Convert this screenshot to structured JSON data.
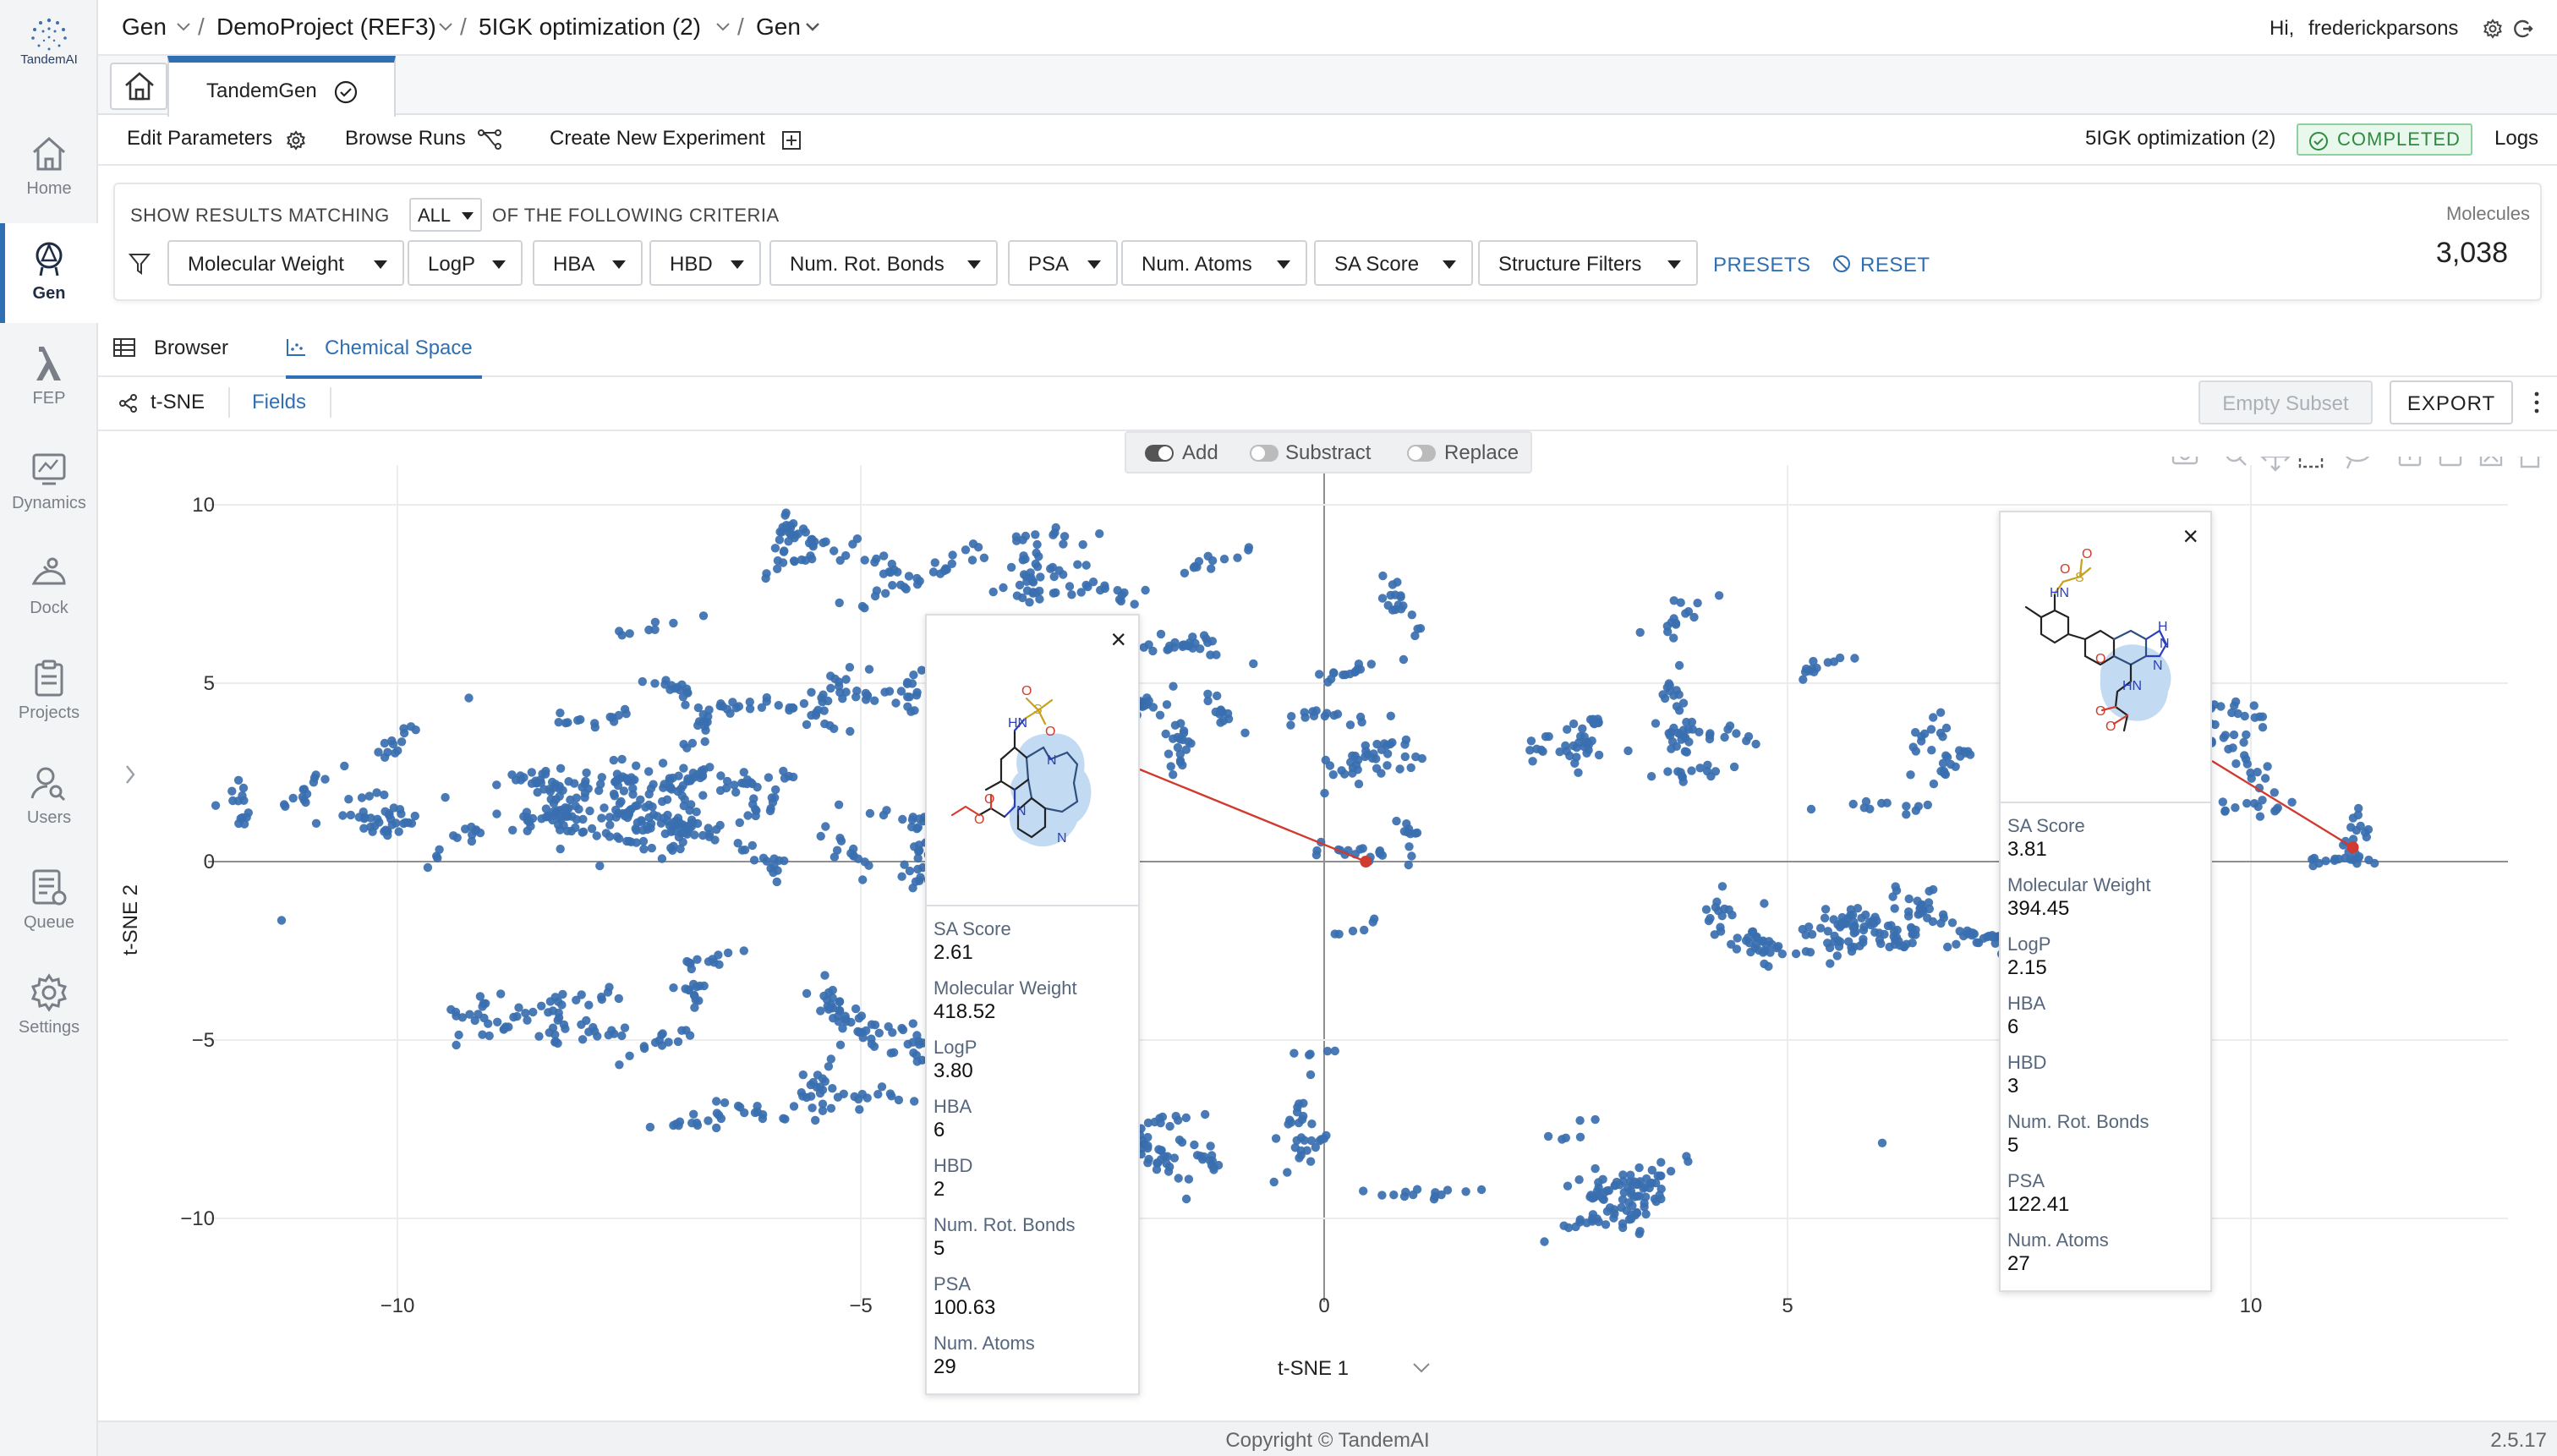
{
  "app": {
    "logo_text": "TandemAI",
    "version": "2.5.17",
    "copyright": "Copyright © TandemAI"
  },
  "nav": {
    "items": [
      {
        "label": "Home",
        "icon": "home-icon"
      },
      {
        "label": "Gen",
        "icon": "gen-icon",
        "active": true
      },
      {
        "label": "FEP",
        "icon": "lambda-icon"
      },
      {
        "label": "Dynamics",
        "icon": "dynamics-icon"
      },
      {
        "label": "Dock",
        "icon": "dock-icon"
      },
      {
        "label": "Projects",
        "icon": "clipboard-icon"
      },
      {
        "label": "Users",
        "icon": "users-icon"
      },
      {
        "label": "Queue",
        "icon": "queue-icon"
      },
      {
        "label": "Settings",
        "icon": "gear-icon"
      }
    ]
  },
  "breadcrumb": {
    "module": "Gen",
    "project": "DemoProject (REF3)",
    "experiment": "5IGK optimization (2)",
    "app": "Gen",
    "separator": "/"
  },
  "user": {
    "greeting": "Hi,",
    "name": "frederickparsons"
  },
  "tabs": {
    "app_tab": "TandemGen"
  },
  "actions": {
    "edit": "Edit Parameters",
    "browse": "Browse Runs",
    "create": "Create New Experiment",
    "run_name": "5IGK optimization (2)",
    "status": "COMPLETED",
    "logs": "Logs"
  },
  "filters": {
    "prefix": "SHOW RESULTS MATCHING",
    "match": "ALL",
    "suffix": "OF THE FOLLOWING CRITERIA",
    "buttons": [
      "Molecular Weight",
      "LogP",
      "HBA",
      "HBD",
      "Num. Rot. Bonds",
      "PSA",
      "Num. Atoms",
      "SA Score",
      "Structure Filters"
    ],
    "presets": "PRESETS",
    "reset": "RESET",
    "molecules_label": "Molecules",
    "molecules_count": "3,038"
  },
  "view_tabs": {
    "browser": "Browser",
    "chemical_space": "Chemical Space"
  },
  "subtoolbar": {
    "method": "t-SNE",
    "fields": "Fields",
    "empty_subset": "Empty Subset",
    "export": "EXPORT"
  },
  "selection": {
    "add": "Add",
    "subtract": "Substract",
    "replace": "Replace"
  },
  "cards": [
    {
      "props": [
        {
          "label": "SA Score",
          "value": "2.61"
        },
        {
          "label": "Molecular Weight",
          "value": "418.52"
        },
        {
          "label": "LogP",
          "value": "3.80"
        },
        {
          "label": "HBA",
          "value": "6"
        },
        {
          "label": "HBD",
          "value": "2"
        },
        {
          "label": "Num. Rot. Bonds",
          "value": "5"
        },
        {
          "label": "PSA",
          "value": "100.63"
        },
        {
          "label": "Num. Atoms",
          "value": "29"
        }
      ]
    },
    {
      "props": [
        {
          "label": "SA Score",
          "value": "3.81"
        },
        {
          "label": "Molecular Weight",
          "value": "394.45"
        },
        {
          "label": "LogP",
          "value": "2.15"
        },
        {
          "label": "HBA",
          "value": "6"
        },
        {
          "label": "HBD",
          "value": "3"
        },
        {
          "label": "Num. Rot. Bonds",
          "value": "5"
        },
        {
          "label": "PSA",
          "value": "122.41"
        },
        {
          "label": "Num. Atoms",
          "value": "27"
        }
      ]
    }
  ],
  "chart_data": {
    "type": "scatter",
    "xlabel": "t-SNE 1",
    "ylabel": "t-SNE 2",
    "xlim": [
      -12,
      12.5
    ],
    "ylim": [
      -11,
      10.5
    ],
    "xticks": [
      -10,
      -5,
      0,
      5,
      10
    ],
    "yticks": [
      10,
      5,
      0,
      -5,
      -10
    ],
    "xtick_labels": [
      "−10",
      "−5",
      "0",
      "5",
      "10"
    ],
    "ytick_labels": [
      "10",
      "5",
      "0",
      "−5",
      "−10"
    ],
    "grid": true,
    "marker_color": "#3a6fb0",
    "highlight_color": "#d03a2f",
    "highlighted_points": [
      [
        0.45,
        0.0
      ],
      [
        11.1,
        0.4
      ]
    ],
    "clusters": [
      {
        "cx": -8.0,
        "cy": 1.3,
        "sx": 1.6,
        "sy": 1.0,
        "n": 340
      },
      {
        "cx": -10.5,
        "cy": 1.3,
        "sx": 0.5,
        "sy": 0.8,
        "n": 40
      },
      {
        "cx": -8.6,
        "cy": -4.0,
        "sx": 0.7,
        "sy": 0.5,
        "n": 70
      },
      {
        "cx": -6.7,
        "cy": -3.8,
        "sx": 0.3,
        "sy": 0.9,
        "n": 40
      },
      {
        "cx": -7.5,
        "cy": 6.3,
        "sx": 0.3,
        "sy": 0.2,
        "n": 8
      },
      {
        "cx": -6.0,
        "cy": 4.2,
        "sx": 1.1,
        "sy": 0.7,
        "n": 110
      },
      {
        "cx": -3.0,
        "cy": 4.2,
        "sx": 1.3,
        "sy": 0.7,
        "n": 120
      },
      {
        "cx": -5.5,
        "cy": 8.6,
        "sx": 0.6,
        "sy": 0.4,
        "n": 45
      },
      {
        "cx": -2.5,
        "cy": 8.3,
        "sx": 2.0,
        "sy": 0.6,
        "n": 120
      },
      {
        "cx": -5.0,
        "cy": 0.7,
        "sx": 1.0,
        "sy": 0.8,
        "n": 70
      },
      {
        "cx": -5.0,
        "cy": -4.2,
        "sx": 0.3,
        "sy": 1.2,
        "n": 60
      },
      {
        "cx": -5.5,
        "cy": -6.5,
        "sx": 0.7,
        "sy": 0.4,
        "n": 35
      },
      {
        "cx": -6.4,
        "cy": -7.4,
        "sx": 0.4,
        "sy": 0.3,
        "n": 25
      },
      {
        "cx": -1.5,
        "cy": -7.7,
        "sx": 1.0,
        "sy": 0.5,
        "n": 90
      },
      {
        "cx": -1.6,
        "cy": -8.6,
        "sx": 0.5,
        "sy": 0.2,
        "n": 25
      },
      {
        "cx": -1.0,
        "cy": 6.2,
        "sx": 0.6,
        "sy": 0.4,
        "n": 25
      },
      {
        "cx": 0.2,
        "cy": 4.5,
        "sx": 0.4,
        "sy": 0.5,
        "n": 30
      },
      {
        "cx": 0.3,
        "cy": 2.8,
        "sx": 0.5,
        "sy": 0.3,
        "n": 40
      },
      {
        "cx": -1.0,
        "cy": 3.2,
        "sx": 0.6,
        "sy": 0.3,
        "n": 20
      },
      {
        "cx": 0.45,
        "cy": 0.0,
        "sx": 0.1,
        "sy": 0.3,
        "n": 18
      },
      {
        "cx": 0.4,
        "cy": -1.8,
        "sx": 0.1,
        "sy": 0.2,
        "n": 6
      },
      {
        "cx": 0.0,
        "cy": -5.2,
        "sx": 0.1,
        "sy": 0.1,
        "n": 5
      },
      {
        "cx": 1.0,
        "cy": 7.4,
        "sx": 0.4,
        "sy": 0.4,
        "n": 18
      },
      {
        "cx": 2.6,
        "cy": -9.5,
        "sx": 0.9,
        "sy": 0.5,
        "n": 110
      },
      {
        "cx": 2.8,
        "cy": 3.8,
        "sx": 0.9,
        "sy": 1.0,
        "n": 80
      },
      {
        "cx": 3.9,
        "cy": 3.5,
        "sx": 0.3,
        "sy": 0.5,
        "n": 20
      },
      {
        "cx": 3.7,
        "cy": 6.8,
        "sx": 0.3,
        "sy": 0.3,
        "n": 15
      },
      {
        "cx": 5.8,
        "cy": 5.5,
        "sx": 0.4,
        "sy": 0.4,
        "n": 12
      },
      {
        "cx": 5.8,
        "cy": 1.3,
        "sx": 0.3,
        "sy": 0.4,
        "n": 12
      },
      {
        "cx": 7.0,
        "cy": -1.7,
        "sx": 1.5,
        "sy": 0.5,
        "n": 160
      },
      {
        "cx": 5.9,
        "cy": -1.8,
        "sx": 0.4,
        "sy": 0.4,
        "n": 30
      },
      {
        "cx": 7.5,
        "cy": 3.0,
        "sx": 0.8,
        "sy": 1.0,
        "n": 60
      },
      {
        "cx": 9.6,
        "cy": 1.8,
        "sx": 0.5,
        "sy": 1.5,
        "n": 80
      },
      {
        "cx": 10.6,
        "cy": 0.5,
        "sx": 0.5,
        "sy": 0.3,
        "n": 30
      },
      {
        "cx": 2.5,
        "cy": -7.3,
        "sx": 0.2,
        "sy": 0.2,
        "n": 6
      },
      {
        "cx": 1.0,
        "cy": 0.3,
        "sx": 0.4,
        "sy": 0.4,
        "n": 10
      },
      {
        "cx": -11.3,
        "cy": -1.5,
        "sx": 0.05,
        "sy": 0.05,
        "n": 1
      },
      {
        "cx": -9.4,
        "cy": 4.9,
        "sx": 0.05,
        "sy": 0.05,
        "n": 1
      },
      {
        "cx": 6.3,
        "cy": -8.1,
        "sx": 0.05,
        "sy": 0.05,
        "n": 1
      }
    ]
  }
}
